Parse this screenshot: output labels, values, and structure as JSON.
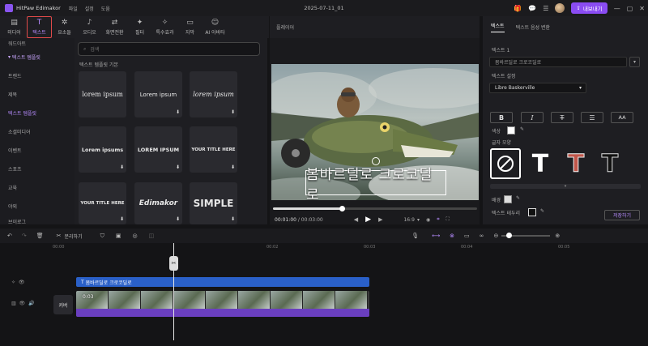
{
  "titlebar": {
    "app_name": "HitPaw Edimakor",
    "menus": [
      "파일",
      "설정",
      "도움"
    ],
    "project_title": "2025-07-11_01",
    "export_label": "내보내기"
  },
  "toolbar": {
    "tools": [
      {
        "label": "미디어",
        "icon": "media-icon"
      },
      {
        "label": "텍스트",
        "icon": "text-icon",
        "active": true
      },
      {
        "label": "요소들",
        "icon": "elements-icon"
      },
      {
        "label": "오디오",
        "icon": "audio-icon"
      },
      {
        "label": "화면전환",
        "icon": "transition-icon"
      },
      {
        "label": "필터",
        "icon": "filter-icon"
      },
      {
        "label": "특수효과",
        "icon": "effects-icon"
      },
      {
        "label": "자막",
        "icon": "subtitle-icon"
      },
      {
        "label": "AI 아바타",
        "icon": "ai-avatar-icon"
      }
    ]
  },
  "leftnav": {
    "items": [
      "워드아트",
      "텍스트 템플릿",
      "트렌드",
      "제목",
      "텍스트 템플릿",
      "소셜미디어",
      "이벤트",
      "스포츠",
      "교육",
      "야외",
      "브이로그"
    ]
  },
  "textlib": {
    "search_placeholder": "검색",
    "section_title": "텍스트 템플릿 기본",
    "tiles": [
      "lorem ipsum",
      "Lorem ipsum",
      "lorem ipsum",
      "Lorem ipsums",
      "LOREM IPSUM",
      "YOUR TITLE HERE",
      "YOUR TITLE HERE",
      "Edimakor",
      "SIMPLE"
    ]
  },
  "player": {
    "header": "플레이어",
    "caption": "봄바르딜로 크로코딜로",
    "time_current": "00:01:00",
    "time_total": "00:03:00",
    "progress": 0.33,
    "aspect": "16:9"
  },
  "rightpanel": {
    "tab_text": "텍스트",
    "tab_tts": "텍스트 음성 변환",
    "label_text1": "텍스트 1",
    "text_value": "봄바르딜로 크로코딜로",
    "label_settings": "텍스트 설정",
    "font": "Libre Baskerville",
    "label_color": "색상",
    "label_style": "글자 모양",
    "label_bg": "배경",
    "label_border": "텍스트 테두리",
    "save_label": "저장하기",
    "caps": "AA"
  },
  "timeline": {
    "split_label": "분리하기",
    "ruler": [
      "00:00",
      "00:02",
      "00:03",
      "00:04",
      "00:05"
    ],
    "text_clip": "봄바르딜로 크로코딜로",
    "video_clip_duration": "0:03",
    "cover_label": "커버"
  }
}
